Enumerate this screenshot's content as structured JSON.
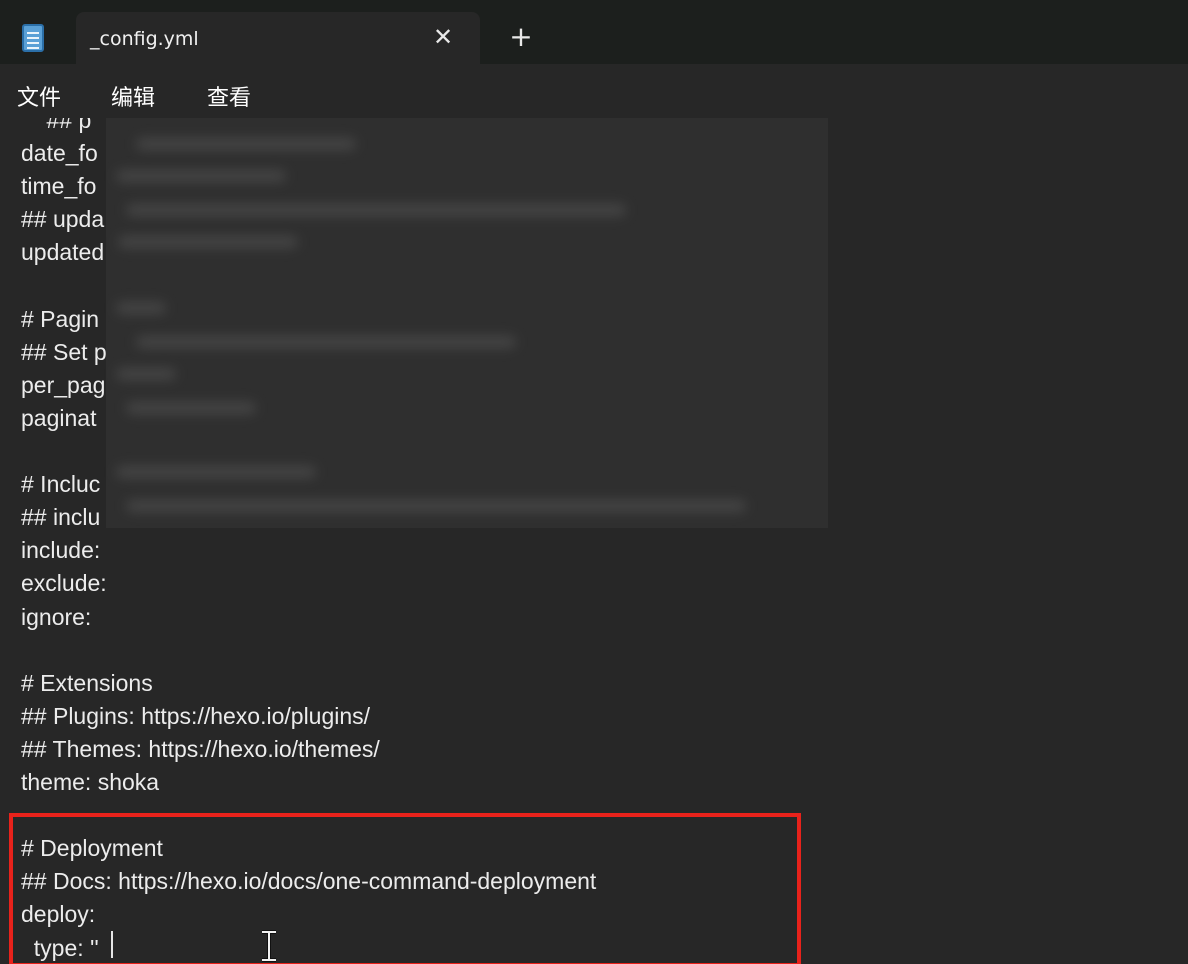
{
  "window": {
    "tab_title": "_config.yml",
    "close_glyph": "✕",
    "new_tab_glyph": "+",
    "app_icon": "notepad-icon"
  },
  "menu": {
    "items": [
      {
        "label": "文件"
      },
      {
        "label": "编辑"
      },
      {
        "label": "查看"
      }
    ]
  },
  "editor": {
    "lines": [
      {
        "text": "    ## p"
      },
      {
        "text": "date_fo"
      },
      {
        "text": "time_fo"
      },
      {
        "text": "## upda"
      },
      {
        "text": "updated"
      },
      {
        "text": ""
      },
      {
        "text": "# Pagin"
      },
      {
        "text": "## Set p"
      },
      {
        "text": "per_pag"
      },
      {
        "text": "paginat"
      },
      {
        "text": ""
      },
      {
        "text": "# Incluc"
      },
      {
        "text": "## inclu"
      },
      {
        "text": "include:"
      },
      {
        "text": "exclude:"
      },
      {
        "text": "ignore:"
      },
      {
        "text": ""
      },
      {
        "text": "# Extensions"
      },
      {
        "text": "## Plugins: https://hexo.io/plugins/"
      },
      {
        "text": "## Themes: https://hexo.io/themes/"
      },
      {
        "text": "theme: shoka"
      },
      {
        "text": ""
      },
      {
        "text": "# Deployment"
      },
      {
        "text": "## Docs: https://hexo.io/docs/one-command-deployment"
      },
      {
        "text": "deploy:"
      },
      {
        "text": "  type: ''"
      }
    ]
  },
  "colors": {
    "background": "#272727",
    "titlebar": "#1c1f1d",
    "text": "#ececec",
    "highlight": "#e8221b"
  }
}
